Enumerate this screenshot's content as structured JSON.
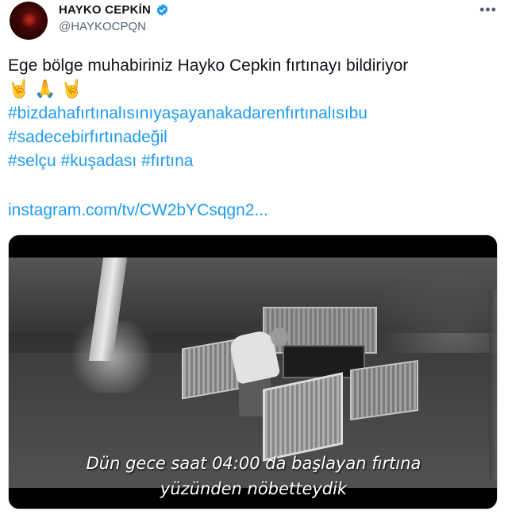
{
  "tweet": {
    "author": {
      "display_name": "HAYKO CEPKİN",
      "handle": "@HAYKOCPQN",
      "verified_icon": "verified-badge-icon"
    },
    "more_icon": "•••",
    "text": {
      "line1": "Ege bölge muhabiriniz Hayko Cepkin fırtınayı bildiriyor",
      "emoji": [
        "🤘",
        "🙏",
        "🤘"
      ],
      "hashtag1": "#bizdahafırtınalısınıyaşayanakadarenfırtınalısıbu",
      "hashtag2": "#sadecebirfırtınadeğil",
      "hashtag3": "#selçu #kuşadası #fırtına",
      "link": "instagram.com/tv/CW2bYCsqgn2..."
    },
    "media": {
      "subtitle_line1": "Dün gece saat 04:00 da başlayan fırtına",
      "subtitle_line2": "yüzünden nöbetteydik"
    }
  },
  "colors": {
    "link": "#1d9bf0",
    "text": "#0f1419",
    "secondary": "#536471",
    "verified": "#1d9bf0"
  }
}
